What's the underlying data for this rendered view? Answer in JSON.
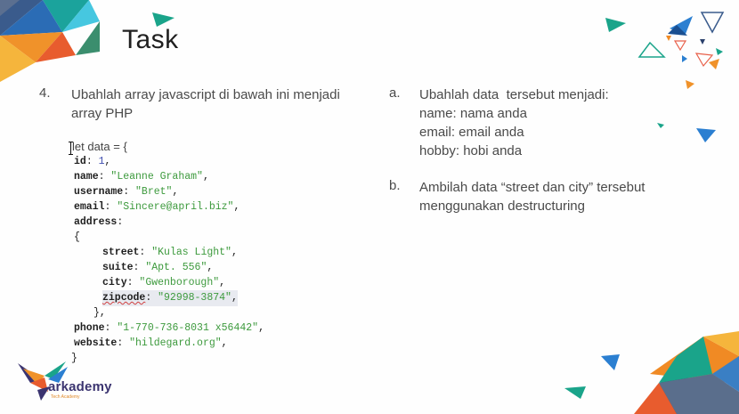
{
  "slide": {
    "title": "Task",
    "task_item": {
      "number": "4.",
      "text": "Ubahlah array javascript di bawah ini menjadi array PHP"
    },
    "code": {
      "header": "let data = {",
      "id_key": "id",
      "id_value": "1",
      "name_key": "name",
      "name_value": "\"Leanne Graham\"",
      "username_key": "username",
      "username_value": "\"Bret\"",
      "email_key": "email",
      "email_value": "\"Sincere@april.biz\"",
      "address_key": "address",
      "open_brace": "{",
      "street_key": "street",
      "street_value": "\"Kulas Light\"",
      "suite_key": "suite",
      "suite_value": "\"Apt. 556\"",
      "city_key": "city",
      "city_value": "\"Gwenborough\"",
      "zipcode_key": "zipcode",
      "zipcode_value": "\"92998-3874\"",
      "close_brace_comma": "},",
      "phone_key": "phone",
      "phone_value": "\"1-770-736-8031 x56442\"",
      "website_key": "website",
      "website_value": "\"hildegard.org\"",
      "close_brace": "}"
    },
    "subtasks": [
      {
        "label": "a.",
        "lines": [
          "Ubahlah data  tersebut menjadi:",
          "name: nama anda",
          "email: email anda",
          "hobby: hobi anda"
        ]
      },
      {
        "label": "b.",
        "lines": [
          "Ambilah data “street dan city” tersebut",
          "menggunakan destructuring"
        ]
      }
    ],
    "logo": {
      "name": "arkademy",
      "tagline": "Tech Academy",
      "icon": "bird-logo-icon"
    }
  },
  "colors": {
    "string": "#3d9a3d",
    "number": "#4150b0",
    "text": "#4a4a4a",
    "teal": "#1aa89a",
    "blue": "#2b7fd1",
    "orange": "#f08a24",
    "navy": "#2a3f6b"
  }
}
